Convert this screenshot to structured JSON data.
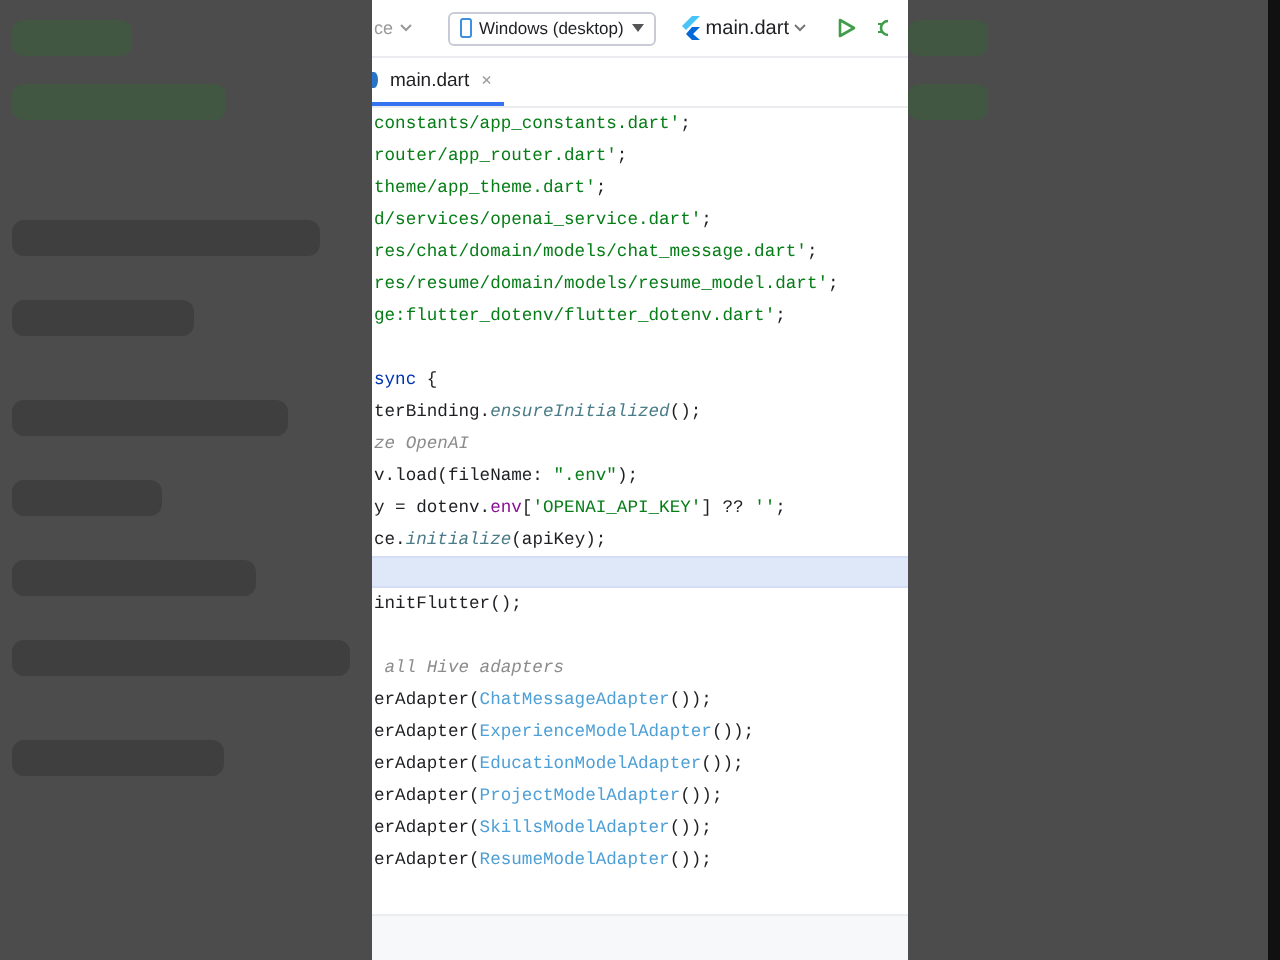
{
  "toolbar": {
    "config_partial": "ce",
    "device": "Windows (desktop)",
    "file": "main.dart"
  },
  "tabs": [
    {
      "label": "main.dart",
      "close": "×",
      "selected": true
    }
  ],
  "code_lines": [
    {
      "current": false,
      "segments": [
        {
          "text": "constants/app_constants.dart'",
          "kind": "string"
        },
        {
          "text": ";",
          "kind": "plain"
        }
      ]
    },
    {
      "current": false,
      "segments": [
        {
          "text": "router/app_router.dart'",
          "kind": "string"
        },
        {
          "text": ";",
          "kind": "plain"
        }
      ]
    },
    {
      "current": false,
      "segments": [
        {
          "text": "theme/app_theme.dart'",
          "kind": "string"
        },
        {
          "text": ";",
          "kind": "plain"
        }
      ]
    },
    {
      "current": false,
      "segments": [
        {
          "text": "d/services/openai_service.dart'",
          "kind": "string"
        },
        {
          "text": ";",
          "kind": "plain"
        }
      ]
    },
    {
      "current": false,
      "segments": [
        {
          "text": "res/chat/domain/models/chat_message.dart'",
          "kind": "string"
        },
        {
          "text": ";",
          "kind": "plain"
        }
      ]
    },
    {
      "current": false,
      "segments": [
        {
          "text": "res/resume/domain/models/resume_model.dart'",
          "kind": "string"
        },
        {
          "text": ";",
          "kind": "plain"
        }
      ]
    },
    {
      "current": false,
      "segments": [
        {
          "text": "ge:flutter_dotenv/flutter_dotenv.dart'",
          "kind": "string"
        },
        {
          "text": ";",
          "kind": "plain"
        }
      ]
    },
    {
      "current": false
    },
    {
      "current": false,
      "segments": [
        {
          "text": "sync",
          "kind": "keyword"
        },
        {
          "text": " {",
          "kind": "plain"
        }
      ]
    },
    {
      "current": false,
      "segments": [
        {
          "text": "terBinding.",
          "kind": "plain"
        },
        {
          "text": "ensureInitialized",
          "kind": "method"
        },
        {
          "text": "();",
          "kind": "plain"
        }
      ]
    },
    {
      "current": false,
      "segments": [
        {
          "text": "ze OpenAI",
          "kind": "comment"
        }
      ]
    },
    {
      "current": false,
      "segments": [
        {
          "text": "v.load(fileName: ",
          "kind": "plain"
        },
        {
          "text": "\".env\"",
          "kind": "string"
        },
        {
          "text": ");",
          "kind": "plain"
        }
      ]
    },
    {
      "current": false,
      "segments": [
        {
          "text": "y = dotenv.",
          "kind": "plain"
        },
        {
          "text": "env",
          "kind": "field"
        },
        {
          "text": "[",
          "kind": "plain"
        },
        {
          "text": "'OPENAI_API_KEY'",
          "kind": "string"
        },
        {
          "text": "] ?? ",
          "kind": "plain"
        },
        {
          "text": "''",
          "kind": "string"
        },
        {
          "text": ";",
          "kind": "plain"
        }
      ]
    },
    {
      "current": false,
      "segments": [
        {
          "text": "ce.",
          "kind": "plain"
        },
        {
          "text": "initialize",
          "kind": "method"
        },
        {
          "text": "(apiKey);",
          "kind": "plain"
        }
      ]
    },
    {
      "current": true
    },
    {
      "current": false,
      "segments": [
        {
          "text": "initFlutter();",
          "kind": "plain"
        }
      ]
    },
    {
      "current": false
    },
    {
      "current": false,
      "segments": [
        {
          "text": " all Hive adapters",
          "kind": "comment"
        }
      ]
    },
    {
      "current": false,
      "segments": [
        {
          "text": "erAdapter(",
          "kind": "plain"
        },
        {
          "text": "ChatMessageAdapter",
          "kind": "type"
        },
        {
          "text": "());",
          "kind": "plain"
        }
      ]
    },
    {
      "current": false,
      "segments": [
        {
          "text": "erAdapter(",
          "kind": "plain"
        },
        {
          "text": "ExperienceModelAdapter",
          "kind": "type"
        },
        {
          "text": "());",
          "kind": "plain"
        }
      ]
    },
    {
      "current": false,
      "segments": [
        {
          "text": "erAdapter(",
          "kind": "plain"
        },
        {
          "text": "EducationModelAdapter",
          "kind": "type"
        },
        {
          "text": "());",
          "kind": "plain"
        }
      ]
    },
    {
      "current": false,
      "segments": [
        {
          "text": "erAdapter(",
          "kind": "plain"
        },
        {
          "text": "ProjectModelAdapter",
          "kind": "type"
        },
        {
          "text": "());",
          "kind": "plain"
        }
      ]
    },
    {
      "current": false,
      "segments": [
        {
          "text": "erAdapter(",
          "kind": "plain"
        },
        {
          "text": "SkillsModelAdapter",
          "kind": "type"
        },
        {
          "text": "());",
          "kind": "plain"
        }
      ]
    },
    {
      "current": false,
      "segments": [
        {
          "text": "erAdapter(",
          "kind": "plain"
        },
        {
          "text": "ResumeModelAdapter",
          "kind": "type"
        },
        {
          "text": "());",
          "kind": "plain"
        }
      ]
    },
    {
      "current": false
    }
  ]
}
